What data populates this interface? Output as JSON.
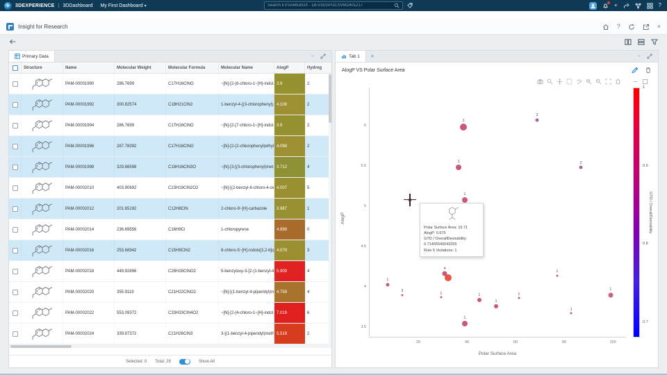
{
  "icons": {
    "caret_down": "▾",
    "plus": "+",
    "minus": "−",
    "close": "×",
    "help": "?"
  },
  "topbar": {
    "brand": "3DEXPERIENCE",
    "sep": "|",
    "product": "3DDashboard",
    "dashboard": "My First Dashboard",
    "search_placeholder": "Search EVSAMEBOX - DEV3DSPOCSVM2401217",
    "right_icons": [
      "user-avatar",
      "notification-bell",
      "add",
      "share",
      "communities",
      "apps-grid",
      "help"
    ]
  },
  "appbar": {
    "title": "Insight for Research",
    "right_icons": [
      "home",
      "help",
      "refresh",
      "open-in-new",
      "close"
    ]
  },
  "left_panel": {
    "tab": "Primary Data",
    "columns": [
      "Structure",
      "Name",
      "Molecular Weight",
      "Molecular Formula",
      "Molecular Name",
      "AlogP",
      "Hydrog"
    ],
    "rows": [
      {
        "name": "PAM-00001990",
        "mw": "286.7699",
        "formula": "C17H16ClNO",
        "mol_name": "~[N]-[2-(6-chloro-1~[H]-indol...",
        "alogp": "3.9",
        "alogp_color": "#96912f",
        "h": "2",
        "selected": false
      },
      {
        "name": "PAM-00001992",
        "mw": "300.82574",
        "formula": "C18H21ClN2",
        "mol_name": "1-benzyl-4-[(3-chlorophenyl)...",
        "alogp": "4.108",
        "alogp_color": "#9e8f33",
        "h": "2",
        "selected": true
      },
      {
        "name": "PAM-00001994",
        "mw": "286.7699",
        "formula": "C17H16ClNO",
        "mol_name": "~[N]-[2-(7-chloro-1~[H]-indol...",
        "alogp": "3.9",
        "alogp_color": "#96912f",
        "h": "2",
        "selected": false
      },
      {
        "name": "PAM-00001996",
        "mw": "287.78392",
        "formula": "C17H18ClNO",
        "mol_name": "~[N]-[2-(2-chlorophenyl)ethyl...",
        "alogp": "4.098",
        "alogp_color": "#9e8f33",
        "h": "2",
        "selected": true
      },
      {
        "name": "PAM-00001998",
        "mw": "329.86598",
        "formula": "C18H16ClN3O",
        "mol_name": "~[N]-[3-[(3-chlorophenyl)met...",
        "alogp": "3.712",
        "alogp_color": "#8f9234",
        "h": "4",
        "selected": true
      },
      {
        "name": "PAM-00002010",
        "mw": "403.90692",
        "formula": "C23H19ClN2O2",
        "mol_name": "~[N]-[(2-benzyl-6-chloro-4-ox...",
        "alogp": "4.007",
        "alogp_color": "#9a9031",
        "h": "5",
        "selected": false
      },
      {
        "name": "PAM-00002012",
        "mw": "201.65192",
        "formula": "C12H8ClN",
        "mol_name": "2-chloro-9~[H]-carbazole",
        "alogp": "3.987",
        "alogp_color": "#999031",
        "h": "1",
        "selected": true
      },
      {
        "name": "PAM-00002014",
        "mw": "236.69556",
        "formula": "C16H9Cl",
        "mol_name": "1-chloropyrene",
        "alogp": "4.899",
        "alogp_color": "#aa6c2c",
        "h": "0",
        "selected": false
      },
      {
        "name": "PAM-00002016",
        "mw": "253.68942",
        "formula": "C15H9ClN2",
        "mol_name": "8-chloro-5~[H]-indolo[3,2-b]q...",
        "alogp": "4.079",
        "alogp_color": "#9c8f32",
        "h": "3",
        "selected": true
      },
      {
        "name": "PAM-00002018",
        "mw": "449.92896",
        "formula": "C28H28ClNO2",
        "mol_name": "5-benzyloxy-3-[2-(1-benzyl-4...",
        "alogp": "5.909",
        "alogp_color": "#e02222",
        "h": "4",
        "selected": false
      },
      {
        "name": "PAM-00002020",
        "mw": "355.9119",
        "formula": "C21H22ClNO2",
        "mol_name": "~[N]-[(1-benzyl-4-piperidyl)m...",
        "alogp": "4.759",
        "alogp_color": "#a8742d",
        "h": "4",
        "selected": false
      },
      {
        "name": "PAM-00002022",
        "mw": "553.09372",
        "formula": "C33H33ClN4O2",
        "mol_name": "~[N]-[2-(4-chloro-1~[H]-indol...",
        "alogp": "7.019",
        "alogp_color": "#e01f1f",
        "h": "6",
        "selected": false
      },
      {
        "name": "PAM-00002024",
        "mw": "339.87372",
        "formula": "C21H26ClN3",
        "mol_name": "3-[(1-benzyl-4-piperidyl)meth...",
        "alogp": "5.519",
        "alogp_color": "#d83c1f",
        "h": "2",
        "selected": false
      }
    ],
    "footer": {
      "selected": "Selected: 0",
      "total": "Total: 29",
      "show_all": "Show All"
    }
  },
  "right_panel": {
    "tab": "Tab 1",
    "chart_title": "AlogP VS Polar Surface Area",
    "modebar_icons": [
      "camera",
      "zoom",
      "pan",
      "box-select",
      "lasso",
      "zoom-in",
      "zoom-out",
      "autoscale",
      "reset-axes",
      "collapse",
      "expand"
    ]
  },
  "tooltip": {
    "lines": [
      "Polar Surface Area: 15.71",
      "AlogP: 5.675",
      "GTD / OverallDesirability:",
      "0.71465546643255",
      "Rule 5 Violations: 1"
    ]
  },
  "chart_data": {
    "type": "scatter",
    "title": "AlogP VS Polar Surface Area",
    "xlabel": "Polar Surface Area",
    "ylabel": "AlogP",
    "xlim": [
      0,
      105.7
    ],
    "ylim": [
      3.371,
      6.474
    ],
    "xticks": [
      20,
      40,
      60,
      80,
      100
    ],
    "yticks": [
      3.5,
      4,
      4.5,
      5,
      5.5,
      6
    ],
    "grid": false,
    "points": [
      {
        "x": 38.6,
        "y": 5.98,
        "r": 5,
        "n": "1",
        "color": "#c13b64"
      },
      {
        "x": 68.9,
        "y": 6.07,
        "r": 2.5,
        "n": "2",
        "color": "#94518f"
      },
      {
        "x": 36.6,
        "y": 5.48,
        "r": 4,
        "n": "1",
        "color": "#c13b64"
      },
      {
        "x": 86.9,
        "y": 5.48,
        "r": 2.5,
        "n": "2",
        "color": "#94518f"
      },
      {
        "x": 39.1,
        "y": 5.08,
        "r": 4,
        "n": "1",
        "color": "#c13b64"
      },
      {
        "x": 16.6,
        "y": 5.08,
        "r": 2.5,
        "n": "",
        "color": "#c13b64"
      },
      {
        "x": 30.9,
        "y": 4.16,
        "r": 3.5,
        "n": "4",
        "color": "#c13b64"
      },
      {
        "x": 32.3,
        "y": 4.11,
        "r": 5,
        "n": "",
        "color": "#e03b28"
      },
      {
        "x": 7.4,
        "y": 4.03,
        "r": 2.5,
        "n": "1",
        "color": "#c13b64"
      },
      {
        "x": 13.4,
        "y": 3.9,
        "r": 1.5,
        "n": "3",
        "color": "#c13b64"
      },
      {
        "x": 29.4,
        "y": 3.87,
        "r": 1.5,
        "n": "1",
        "color": "#c13b64"
      },
      {
        "x": 45.1,
        "y": 3.84,
        "r": 3,
        "n": "1",
        "color": "#b83a6a"
      },
      {
        "x": 52.0,
        "y": 3.76,
        "r": 3,
        "n": "1",
        "color": "#b83a6a"
      },
      {
        "x": 61.4,
        "y": 3.86,
        "r": 1.5,
        "n": "1",
        "color": "#c13b64"
      },
      {
        "x": 77.1,
        "y": 4.14,
        "r": 1.5,
        "n": "1",
        "color": "#c13b64"
      },
      {
        "x": 99.1,
        "y": 3.9,
        "r": 3.5,
        "n": "1",
        "color": "#bf4573"
      },
      {
        "x": 82.9,
        "y": 3.67,
        "r": 1.5,
        "n": "1",
        "color": "#c13b64"
      },
      {
        "x": 39.1,
        "y": 3.54,
        "r": 4,
        "n": "1",
        "color": "#c13b64"
      }
    ],
    "hover": {
      "x": 16.6,
      "y": 5.08
    },
    "colorbar": {
      "label": "GTD / OverallDesirability",
      "min": 0.68,
      "max": 1.0,
      "ticks": [
        "1",
        "0.9",
        "0.8",
        "0.7"
      ],
      "top_color": "#ff0000",
      "bottom_color": "#0000ff",
      "legend_position": "right"
    }
  }
}
